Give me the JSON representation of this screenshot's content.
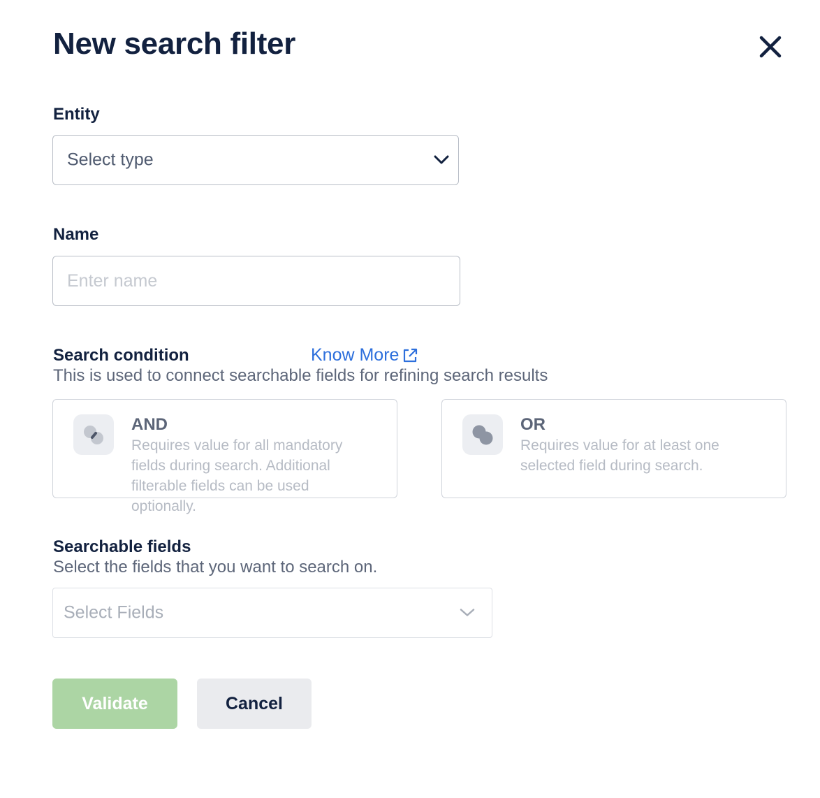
{
  "dialog": {
    "title": "New search filter"
  },
  "entity": {
    "label": "Entity",
    "selected": "Select type"
  },
  "name": {
    "label": "Name",
    "placeholder": "Enter name",
    "value": ""
  },
  "search_condition": {
    "label": "Search condition",
    "know_more": "Know More",
    "description": "This is used to connect searchable fields for refining search results",
    "options": [
      {
        "title": "AND",
        "description": "Requires value for all mandatory fields during search. Additional filterable fields can be used optionally."
      },
      {
        "title": "OR",
        "description": "Requires value for at least one selected field during search."
      }
    ]
  },
  "searchable_fields": {
    "label": "Searchable fields",
    "description": "Select the fields that you want to search on.",
    "placeholder": "Select Fields"
  },
  "actions": {
    "validate": "Validate",
    "cancel": "Cancel"
  },
  "colors": {
    "heading": "#12213f",
    "link": "#2d6fdc",
    "validate_bg": "#acd5a4",
    "cancel_bg": "#eaebee"
  },
  "icons": {
    "close": "close-icon",
    "dropdown": "chevron-down-icon",
    "external_link": "external-link-icon",
    "and_condition": "and-condition-icon",
    "or_condition": "or-condition-icon"
  }
}
